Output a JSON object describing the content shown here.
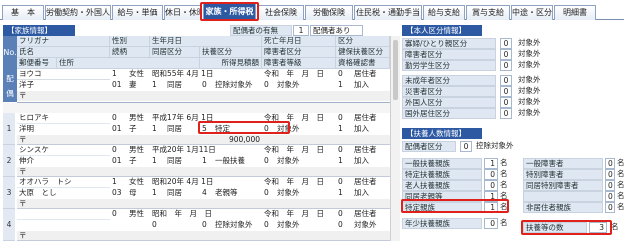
{
  "tabs": [
    "基　本",
    "労働契約・外国人",
    "給与・単価",
    "休日・休暇",
    "家族・所得税",
    "社会保険",
    "労働保険",
    "住民税・通勤手当",
    "給与支給",
    "賞与支給",
    "中途・区分",
    "明細書"
  ],
  "active_tab": "家族・所得税",
  "family": {
    "section_title": "【家族情報】",
    "spouse_label": "配偶者の有無",
    "spouse_value": "1",
    "spouse_status": "配偶者あり",
    "col_no": "No.",
    "headers_r1": [
      "フリガナ",
      "性別",
      "生年月日",
      "死亡年月日",
      "区分"
    ],
    "headers_r2": [
      "氏名",
      "続柄",
      "同居区分",
      "扶養区分",
      "障害者区分",
      "健保扶養区分"
    ],
    "headers_r3": [
      "郵便番号",
      "住所",
      "所得見積額",
      "障害者等級",
      "資格確認書"
    ],
    "spouse_side_label": "配偶",
    "spouse_row": {
      "kana": "ヨウコ",
      "gender_code": "1",
      "gender": "女性",
      "birth": "昭和55年 4月 1日",
      "death": "令和　年　月　日",
      "div_code": "0",
      "div": "居住者",
      "name": "洋子",
      "rel_code": "01",
      "rel": "妻",
      "cohab_code": "1",
      "cohab": "同居",
      "dep_code": "0",
      "dep": "控除対象外",
      "dis_code": "0",
      "dis": "対象外",
      "hi_code": "1",
      "hi": "加入",
      "zip": "〒"
    },
    "rows": [
      {
        "no": "1",
        "kana": "ヒロアキ",
        "gender_code": "0",
        "gender": "男性",
        "birth": "平成17年 6月 1日",
        "death": "令和　年　月　日",
        "div_code": "0",
        "div": "居住者",
        "name": "洋明",
        "rel_code": "01",
        "rel": "子",
        "cohab_code": "1",
        "cohab": "同居",
        "dep_code": "5",
        "dep": "特定",
        "dis_code": "0",
        "dis": "対象外",
        "hi_code": "1",
        "hi": "加入",
        "zip": "〒",
        "income": "900,000"
      },
      {
        "no": "2",
        "kana": "シンスケ",
        "gender_code": "0",
        "gender": "男性",
        "birth": "平成20年 1月11日",
        "death": "令和　年　月　日",
        "div_code": "0",
        "div": "居住者",
        "name": "伸介",
        "rel_code": "01",
        "rel": "子",
        "cohab_code": "1",
        "cohab": "同居",
        "dep_code": "1",
        "dep": "一般扶養",
        "dis_code": "0",
        "dis": "対象外",
        "hi_code": "1",
        "hi": "加入",
        "zip": "〒",
        "income": ""
      },
      {
        "no": "3",
        "kana": "オオハラ　トシ",
        "gender_code": "1",
        "gender": "女性",
        "birth": "昭和20年 4月 1日",
        "death": "令和　年　月　日",
        "div_code": "0",
        "div": "居住者",
        "name": "大原　とし",
        "rel_code": "03",
        "rel": "母",
        "cohab_code": "1",
        "cohab": "同居",
        "dep_code": "4",
        "dep": "老親等",
        "dis_code": "0",
        "dis": "対象外",
        "hi_code": "1",
        "hi": "加入",
        "zip": "〒",
        "income": ""
      },
      {
        "no": "4",
        "kana": "",
        "gender_code": "0",
        "gender": "男性",
        "birth": "昭和　年　月　日",
        "death": "令和　年　月　日",
        "div_code": "0",
        "div": "居住者",
        "name": "",
        "rel_code": "",
        "rel": "",
        "cohab_code": "0",
        "cohab": "",
        "dep_code": "0",
        "dep": "控除対象外",
        "dis_code": "0",
        "dis": "対象外",
        "hi_code": "0",
        "hi": "対象外",
        "zip": "〒",
        "income": ""
      }
    ]
  },
  "self_info": {
    "title": "【本人区分情報】",
    "rows": [
      {
        "label": "寡婦/ひとり親区分",
        "code": "0",
        "value": "対象外"
      },
      {
        "label": "障害者区分",
        "code": "0",
        "value": "対象外"
      },
      {
        "label": "勤労学生区分",
        "code": "0",
        "value": "対象外"
      },
      {
        "label": "未成年者区分",
        "code": "0",
        "value": "対象外"
      },
      {
        "label": "災害者区分",
        "code": "0",
        "value": "対象外"
      },
      {
        "label": "外国人区分",
        "code": "0",
        "value": "対象外"
      },
      {
        "label": "国外居住区分",
        "code": "0",
        "value": "対象外"
      }
    ]
  },
  "dependents": {
    "title": "【扶養人数情報】",
    "spouse_div_label": "配偶者区分",
    "spouse_div_code": "0",
    "spouse_div_value": "控除対象外",
    "unit": "名",
    "left": [
      {
        "label": "一般扶養親族",
        "count": "1"
      },
      {
        "label": "特定扶養親族",
        "count": "0"
      },
      {
        "label": "老人扶養親族",
        "count": "0"
      },
      {
        "label": "同居老親等",
        "count": "1"
      },
      {
        "label": "特定親族",
        "count": "1"
      },
      {
        "label": "年少扶養親族",
        "count": "0"
      }
    ],
    "right": [
      {
        "label": "一般障害者",
        "count": "0"
      },
      {
        "label": "特別障害者",
        "count": "0"
      },
      {
        "label": "同居特別障害者",
        "count": "0"
      },
      {
        "label": "",
        "count": "0"
      },
      {
        "label": "非居住者親族",
        "count": "0"
      }
    ],
    "total_label": "扶養等の数",
    "total_count": "3"
  },
  "colors": {
    "accent": "#2d59a3",
    "highlight": "#e0201a",
    "header_bg": "#dfe7f2"
  }
}
